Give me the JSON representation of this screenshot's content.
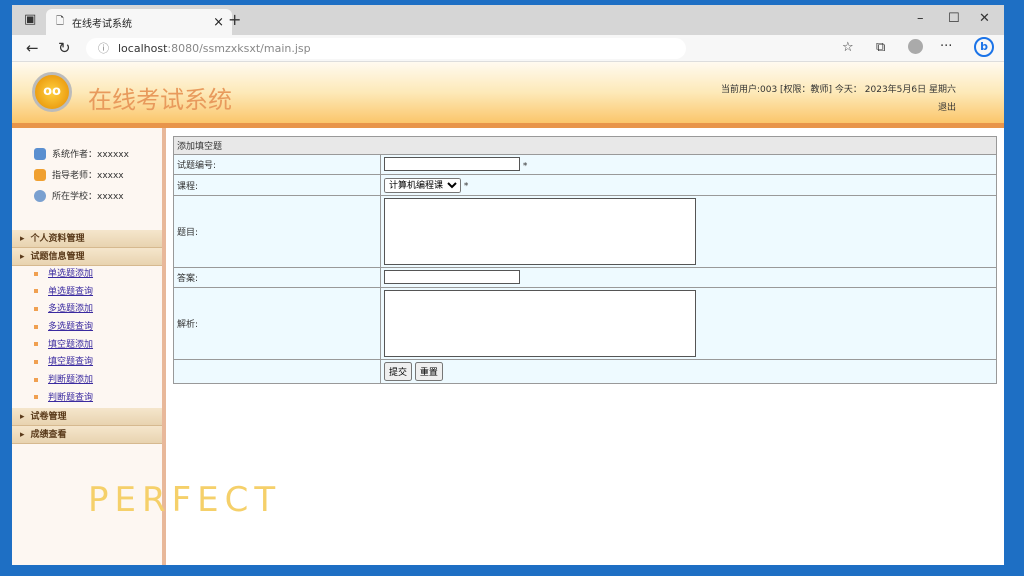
{
  "browser": {
    "tab_title": "在线考试系统",
    "url_host": "localhost",
    "url_path": ":8080/ssmzxksxt/main.jsp"
  },
  "header": {
    "title": "在线考试系统",
    "logo": "oo",
    "user_info": "当前用户:003 [权限：教师] 今天： 2023年5月6日 星期六",
    "logout": "退出"
  },
  "sidebar": {
    "info": [
      {
        "label": "系统作者：xxxxxx",
        "color": "#5a8fd0"
      },
      {
        "label": "指导老师：xxxxx",
        "color": "#f0a030"
      },
      {
        "label": "所在学校：xxxxx",
        "color": "#7aa0d0"
      }
    ],
    "menus": [
      {
        "label": "个人资料管理"
      },
      {
        "label": "试题信息管理"
      }
    ],
    "sub_items": [
      "单选题添加",
      "单选题查询",
      "多选题添加",
      "多选题查询",
      "填空题添加",
      "填空题查询",
      "判断题添加",
      "判断题查询"
    ],
    "menus2": [
      {
        "label": "试卷管理"
      },
      {
        "label": "成绩查看"
      }
    ]
  },
  "form": {
    "title": "添加填空题",
    "id_label": "试题编号:",
    "course_label": "课程:",
    "course_value": "计算机编程课",
    "required": "*",
    "question_label": "题目:",
    "answer_label": "答案:",
    "analysis_label": "解析:",
    "submit": "提交",
    "reset": "重置"
  },
  "overlay": {
    "sticker_text": "PERFECT"
  }
}
